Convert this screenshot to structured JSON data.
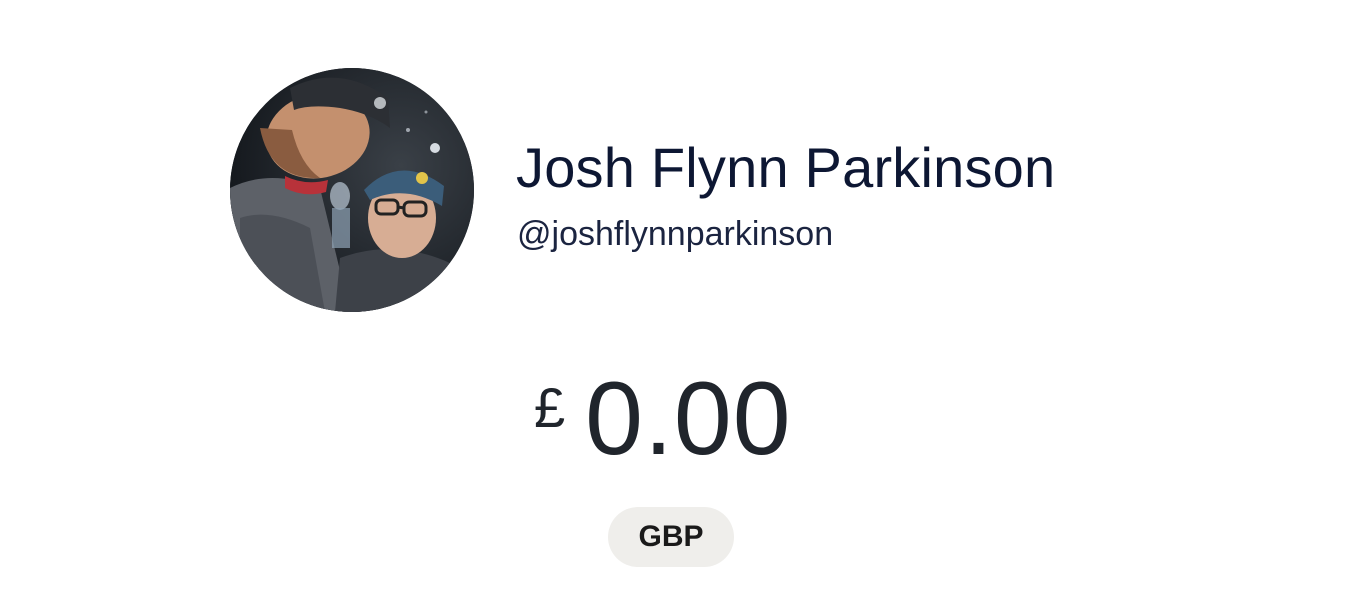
{
  "profile": {
    "name": "Josh Flynn Parkinson",
    "handle": "@joshflynnparkinson",
    "avatar_icon": "profile-photo"
  },
  "payment": {
    "currency_symbol": "£",
    "amount": "0.00",
    "currency_code": "GBP"
  },
  "colors": {
    "text_primary": "#0d1733",
    "amount_text": "#20252c",
    "pill_background": "#efeeeb"
  }
}
